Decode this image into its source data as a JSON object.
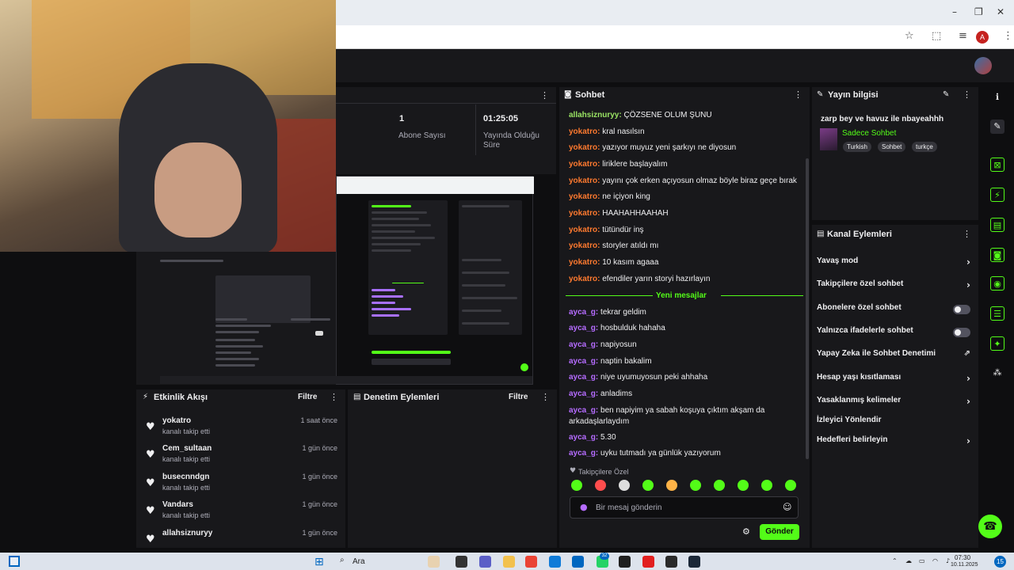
{
  "browser": {
    "minimize": "–",
    "restore": "❐",
    "close": "✕",
    "profile_initial": "A",
    "icons": [
      "star-icon",
      "extensions-icon",
      "media-icon",
      "profile-icon",
      "menu-icon"
    ]
  },
  "stats": {
    "subscribers_value": "1",
    "subscribers_label": "Abone Sayısı",
    "uptime_value": "01:25:05",
    "uptime_label": "Yayında Olduğu Süre"
  },
  "activity": {
    "title": "Etkinlik Akışı",
    "filter": "Filtre",
    "items": [
      {
        "name": "yokatro",
        "sub": "kanalı takip etti",
        "time": "1 saat önce"
      },
      {
        "name": "Cem_sultaan",
        "sub": "kanalı takip etti",
        "time": "1 gün önce"
      },
      {
        "name": "busecnndgn",
        "sub": "kanalı takip etti",
        "time": "1 gün önce"
      },
      {
        "name": "Vandars",
        "sub": "kanalı takip etti",
        "time": "1 gün önce"
      },
      {
        "name": "allahsiznuryy",
        "sub": "",
        "time": "1 gün önce"
      }
    ]
  },
  "moderation": {
    "title": "Denetim Eylemleri",
    "filter": "Filtre"
  },
  "chat": {
    "title": "Sohbet",
    "messages": [
      {
        "user": "allahsiznuryy",
        "text": " ÇÖZSENE OLUM ŞUNU"
      },
      {
        "user": "yokatro",
        "text": " kral nasılsın"
      },
      {
        "user": "yokatro",
        "text": " yazıyor muyuz yeni şarkıyı ne diyosun"
      },
      {
        "user": "yokatro",
        "text": " liriklere başlayalım"
      },
      {
        "user": "yokatro",
        "text": " yayını çok erken açıyosun olmaz böyle biraz geçe bırak"
      },
      {
        "user": "yokatro",
        "text": " ne içiyon king"
      },
      {
        "user": "yokatro",
        "text": " HAAHAHHAAHAH"
      },
      {
        "user": "yokatro",
        "text": " tütündür inş"
      },
      {
        "user": "yokatro",
        "text": " storyler atıldı mı"
      },
      {
        "user": "yokatro",
        "text": " 10 kasım agaaa"
      },
      {
        "user": "yokatro",
        "text": " efendiler yarın storyi hazırlayın"
      }
    ],
    "new_messages_label": "Yeni mesajlar",
    "new_messages": [
      {
        "user": "ayca_g",
        "text": " tekrar geldim"
      },
      {
        "user": "ayca_g",
        "text": " hosbulduk hahaha"
      },
      {
        "user": "ayca_g",
        "text": " napiyosun"
      },
      {
        "user": "ayca_g",
        "text": " naptin bakalim"
      },
      {
        "user": "ayca_g",
        "text": " niye uyumuyosun peki ahhaha"
      },
      {
        "user": "ayca_g",
        "text": " anladims"
      },
      {
        "user": "ayca_g",
        "text": " ben napiyim ya sabah koşuya çıktım akşam da arkadaşlarlaydım"
      },
      {
        "user": "ayca_g",
        "text": " 5.30"
      },
      {
        "user": "ayca_g",
        "text": " uyku tutmadı ya günlük yazıyorum"
      }
    ],
    "followers_only": "Takipçilere Özel",
    "input_placeholder": "Bir mesaj gönderin",
    "send_label": "Gönder"
  },
  "stream_info": {
    "title": "Yayın bilgisi",
    "stream_title": "zarp bey ve havuz ile nbayeahhh",
    "category": "Sadece Sohbet",
    "tags": [
      "Turkish",
      "Sohbet",
      "turkçe"
    ]
  },
  "channel_actions": {
    "title": "Kanal Eylemleri",
    "items": [
      {
        "label": "Yavaş mod",
        "control": "chevron"
      },
      {
        "label": "Takipçilere özel sohbet",
        "control": "chevron"
      },
      {
        "label": "Abonelere özel sohbet",
        "control": "toggle"
      },
      {
        "label": "Yalnızca ifadelerle sohbet",
        "control": "toggle"
      },
      {
        "label": "Yapay Zeka ile Sohbet Denetimi",
        "control": "external"
      },
      {
        "label": "Hesap yaşı kısıtlaması",
        "control": "chevron"
      },
      {
        "label": "Yasaklanmış kelimeler",
        "control": "chevron"
      },
      {
        "label": "İzleyici Yönlendir",
        "control": "none"
      },
      {
        "label": "Hedefleri belirleyin",
        "control": "chevron"
      }
    ]
  },
  "taskbar": {
    "search_label": "Ara",
    "time": "07:30",
    "date": "10.11.2025",
    "notification_count": "15",
    "badge_count": "32"
  }
}
